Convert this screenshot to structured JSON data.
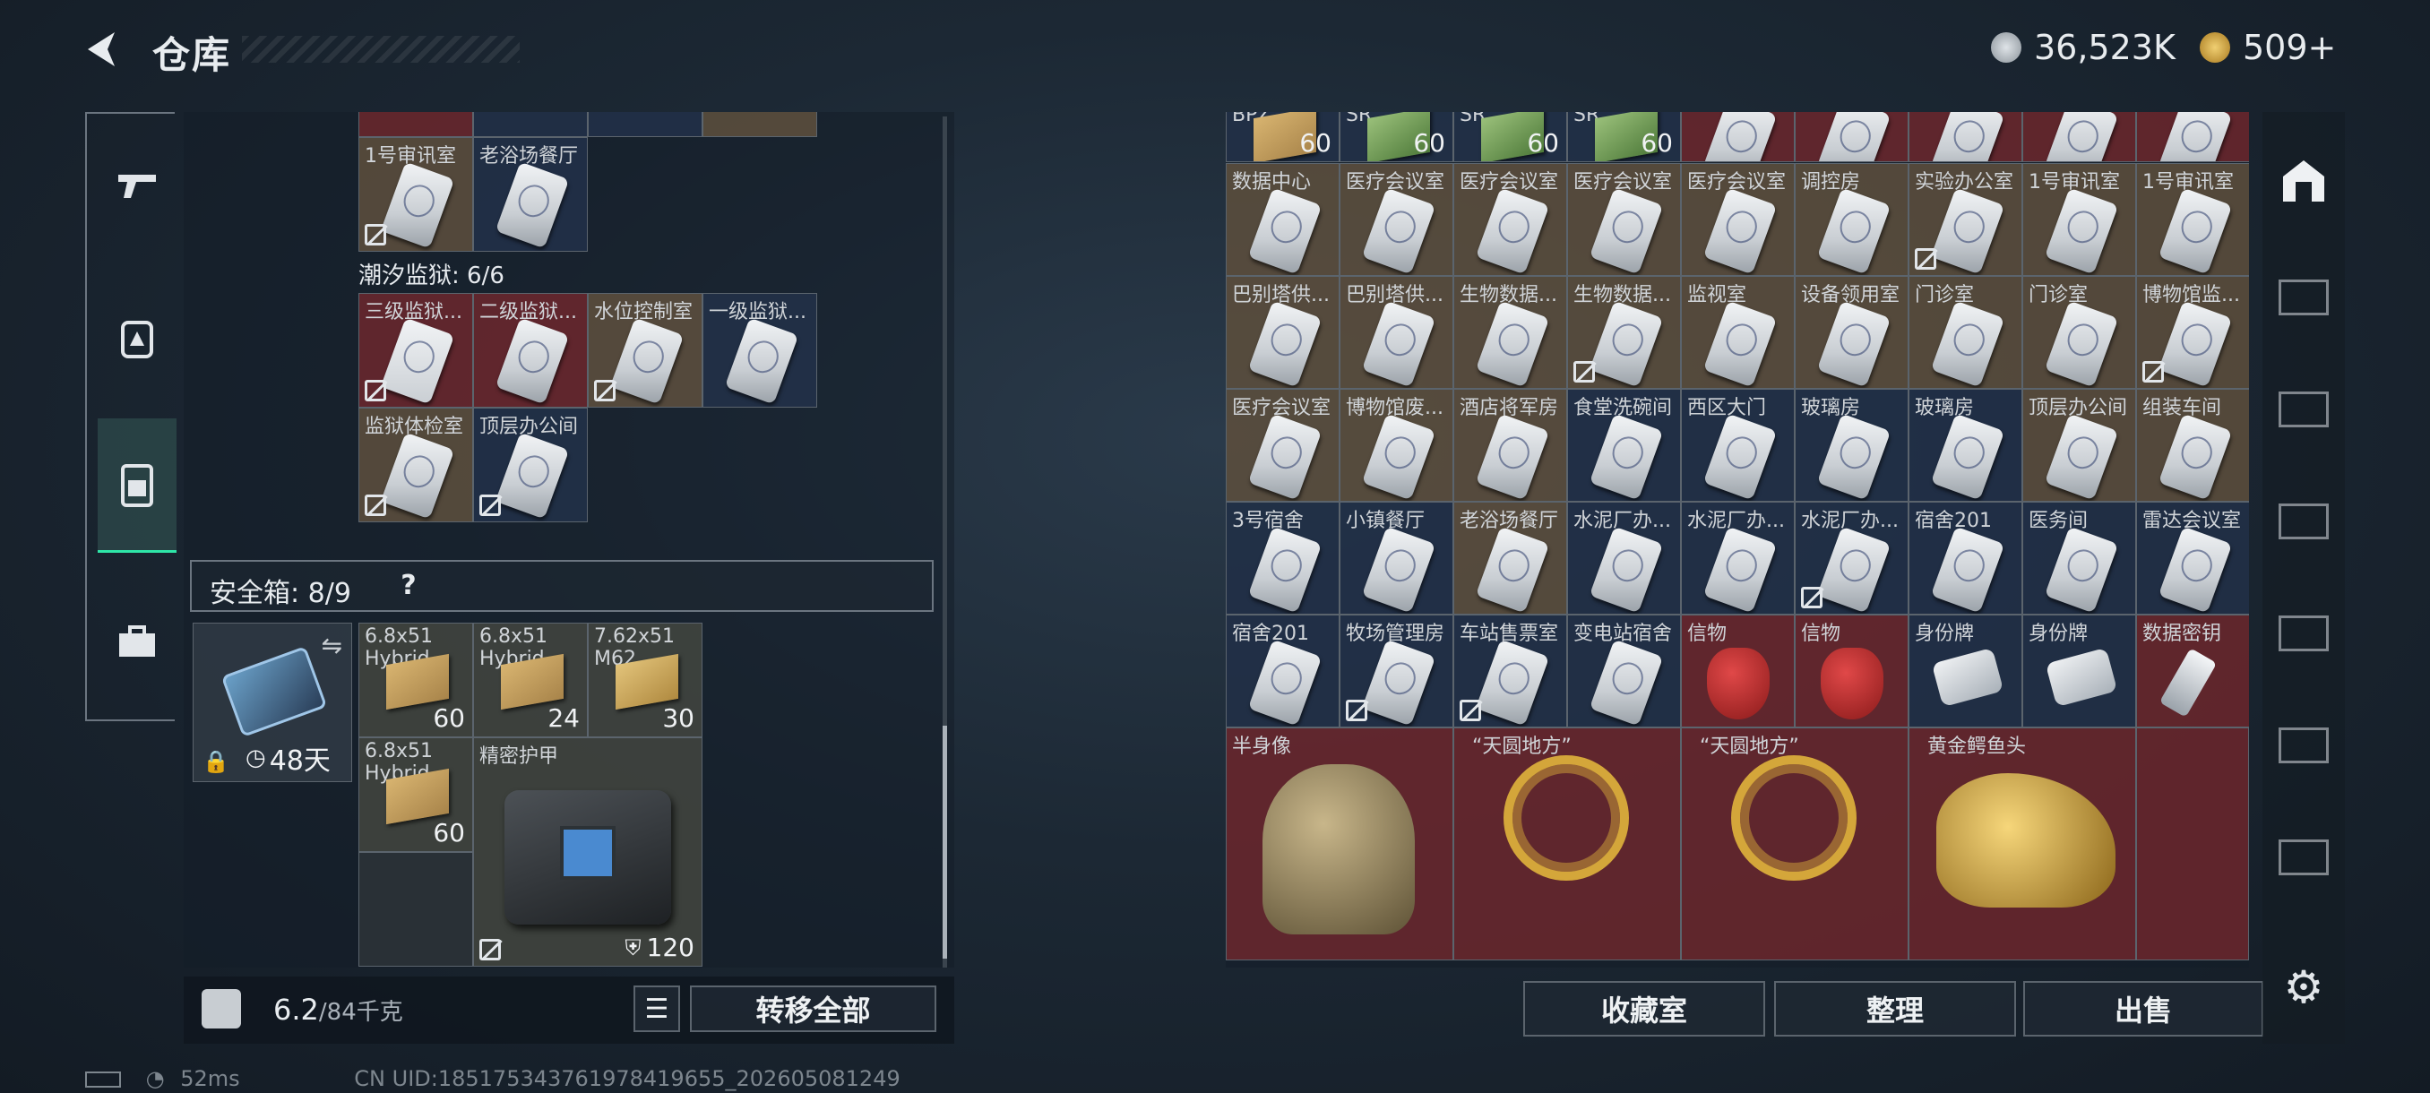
{
  "header": {
    "title": "仓库"
  },
  "currency": [
    {
      "name": "coin-silver-icon",
      "value": "36,523K",
      "color": "#b8c0c8"
    },
    {
      "name": "coin-gold-icon",
      "value": "509",
      "suffix": "+",
      "color": "#d9a93e"
    }
  ],
  "left_rail": [
    "gun-icon",
    "backpack-icon",
    "vest-icon",
    "toolbox-icon"
  ],
  "stash": {
    "top_items": [
      {
        "label": "1号审讯室"
      },
      {
        "label": "老浴场餐厅"
      }
    ],
    "prison_title": "潮汐监狱: 6/6",
    "prison_items": [
      {
        "label": "三级监狱..."
      },
      {
        "label": "二级监狱..."
      },
      {
        "label": "水位控制室"
      },
      {
        "label": "一级监狱..."
      },
      {
        "label": "监狱体检室"
      },
      {
        "label": "顶层办公间"
      }
    ],
    "safe_title": "安全箱: 8/9",
    "safe_help": "?",
    "safe_days": "48天",
    "safe_items": [
      {
        "label": "6.8x51\nHybrid",
        "count": "60"
      },
      {
        "label": "6.8x51\nHybrid",
        "count": "24"
      },
      {
        "label": "7.62x51\nM62",
        "count": "30"
      },
      {
        "label": "6.8x51\nHybrid",
        "count": "60"
      },
      {
        "label": "精密护甲",
        "count": "120"
      }
    ]
  },
  "footer_left": {
    "weight": "6.2",
    "capacity": "/84千克",
    "transfer_all": "转移全部"
  },
  "collection": {
    "row0": [
      {
        "label": "BPZ",
        "count": "60"
      },
      {
        "label": "SR",
        "count": "60"
      },
      {
        "label": "SR",
        "count": "60"
      },
      {
        "label": "SR",
        "count": "60"
      }
    ],
    "rows": [
      [
        "数据中心",
        "医疗会议室",
        "医疗会议室",
        "医疗会议室",
        "医疗会议室",
        "调控房",
        "实验办公室",
        "1号审讯室",
        "1号审讯室"
      ],
      [
        "巴别塔供...",
        "巴别塔供...",
        "生物数据...",
        "生物数据...",
        "监视室",
        "设备领用室",
        "门诊室",
        "门诊室",
        "博物馆监..."
      ],
      [
        "医疗会议室",
        "博物馆废...",
        "酒店将军房",
        "食堂洗碗间",
        "西区大门",
        "玻璃房",
        "玻璃房",
        "顶层办公间",
        "组装车间"
      ],
      [
        "3号宿舍",
        "小镇餐厅",
        "老浴场餐厅",
        "水泥厂办...",
        "水泥厂办...",
        "水泥厂办...",
        "宿舍201",
        "医务间",
        "雷达会议室"
      ],
      [
        "宿舍201",
        "牧场管理房",
        "车站售票室",
        "变电站宿舍",
        "信物",
        "信物",
        "身份牌",
        "身份牌",
        "数据密钥"
      ]
    ],
    "big_items": [
      {
        "label": "半身像"
      },
      {
        "label": "“天圆地方”"
      },
      {
        "label": "“天圆地方”"
      },
      {
        "label": "黄金鳄鱼头"
      }
    ]
  },
  "footer_right": {
    "collection_room": "收藏室",
    "organize": "整理",
    "sell": "出售"
  },
  "status": {
    "ping": "52ms",
    "uid": "CN UID:1851753437619784196​55_202605081249"
  }
}
